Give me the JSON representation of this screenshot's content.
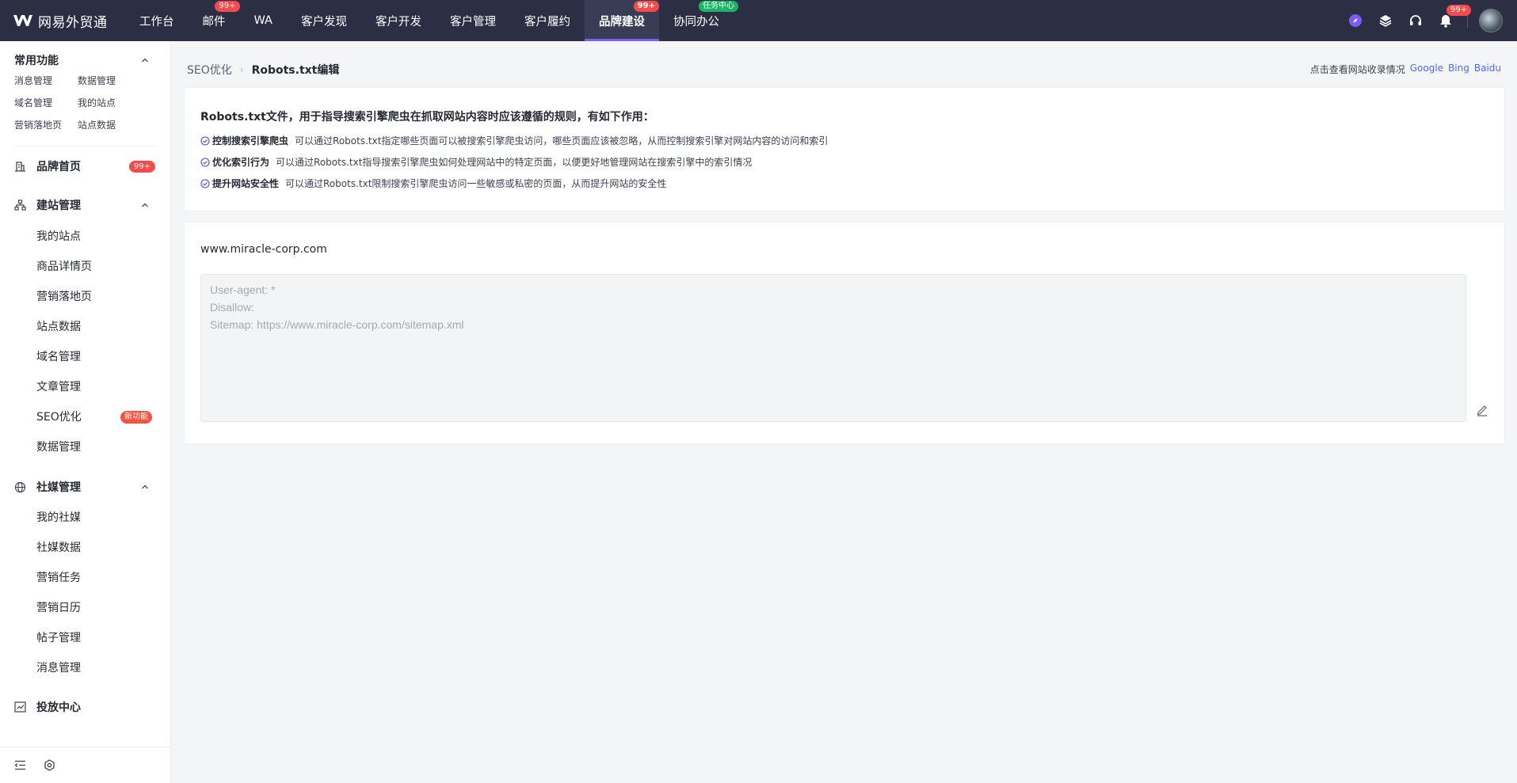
{
  "app": {
    "logo_text": "网易外贸通"
  },
  "nav": {
    "items": [
      {
        "label": "工作台",
        "badge": ""
      },
      {
        "label": "邮件",
        "badge": "99+"
      },
      {
        "label": "WA",
        "badge": ""
      },
      {
        "label": "客户发现",
        "badge": ""
      },
      {
        "label": "客户开发",
        "badge": ""
      },
      {
        "label": "客户管理",
        "badge": ""
      },
      {
        "label": "客户履约",
        "badge": ""
      },
      {
        "label": "品牌建设",
        "badge": "99+"
      },
      {
        "label": "协同办公",
        "badge": "任务中心"
      }
    ],
    "active": "品牌建设",
    "notification_badge": "99+"
  },
  "sidebar": {
    "common": {
      "title": "常用功能",
      "items": [
        "消息管理",
        "数据管理",
        "域名管理",
        "我的站点",
        "营销落地页",
        "站点数据"
      ]
    },
    "brand_home": {
      "label": "品牌首页",
      "badge": "99+"
    },
    "site_mgmt": {
      "title": "建站管理",
      "items": [
        "我的站点",
        "商品详情页",
        "营销落地页",
        "站点数据",
        "域名管理",
        "文章管理",
        "SEO优化",
        "数据管理"
      ],
      "seo_badge": "新功能"
    },
    "social_mgmt": {
      "title": "社媒管理",
      "items": [
        "我的社媒",
        "社媒数据",
        "营销任务",
        "营销日历",
        "帖子管理",
        "消息管理"
      ]
    },
    "ads_center": {
      "label": "投放中心"
    }
  },
  "breadcrumb": {
    "parent": "SEO优化",
    "current": "Robots.txt编辑"
  },
  "index_info": {
    "label": "点击查看网站收录情况",
    "links": [
      "Google",
      "Bing",
      "Baidu"
    ]
  },
  "intro": {
    "title": "Robots.txt文件，用于指导搜索引擎爬虫在抓取网站内容时应该遵循的规则，有如下作用：",
    "features": [
      {
        "name": "控制搜索引擎爬虫",
        "desc": "可以通过Robots.txt指定哪些页面可以被搜索引擎爬虫访问，哪些页面应该被忽略，从而控制搜索引擎对网站内容的访问和索引"
      },
      {
        "name": "优化索引行为",
        "desc": "可以通过Robots.txt指导搜索引擎爬虫如何处理网站中的特定页面，以便更好地管理网站在搜索引擎中的索引情况"
      },
      {
        "name": "提升网站安全性",
        "desc": "可以通过Robots.txt限制搜索引擎爬虫访问一些敏感或私密的页面，从而提升网站的安全性"
      }
    ]
  },
  "editor": {
    "domain": "www.miracle-corp.com",
    "content": "User-agent: *\nDisallow:\nSitemap: https://www.miracle-corp.com/sitemap.xml"
  },
  "colors": {
    "topbar": "#2c2e44",
    "accent": "#7d5cf5",
    "badge": "#f74b4b",
    "link": "#4a6cf7"
  }
}
